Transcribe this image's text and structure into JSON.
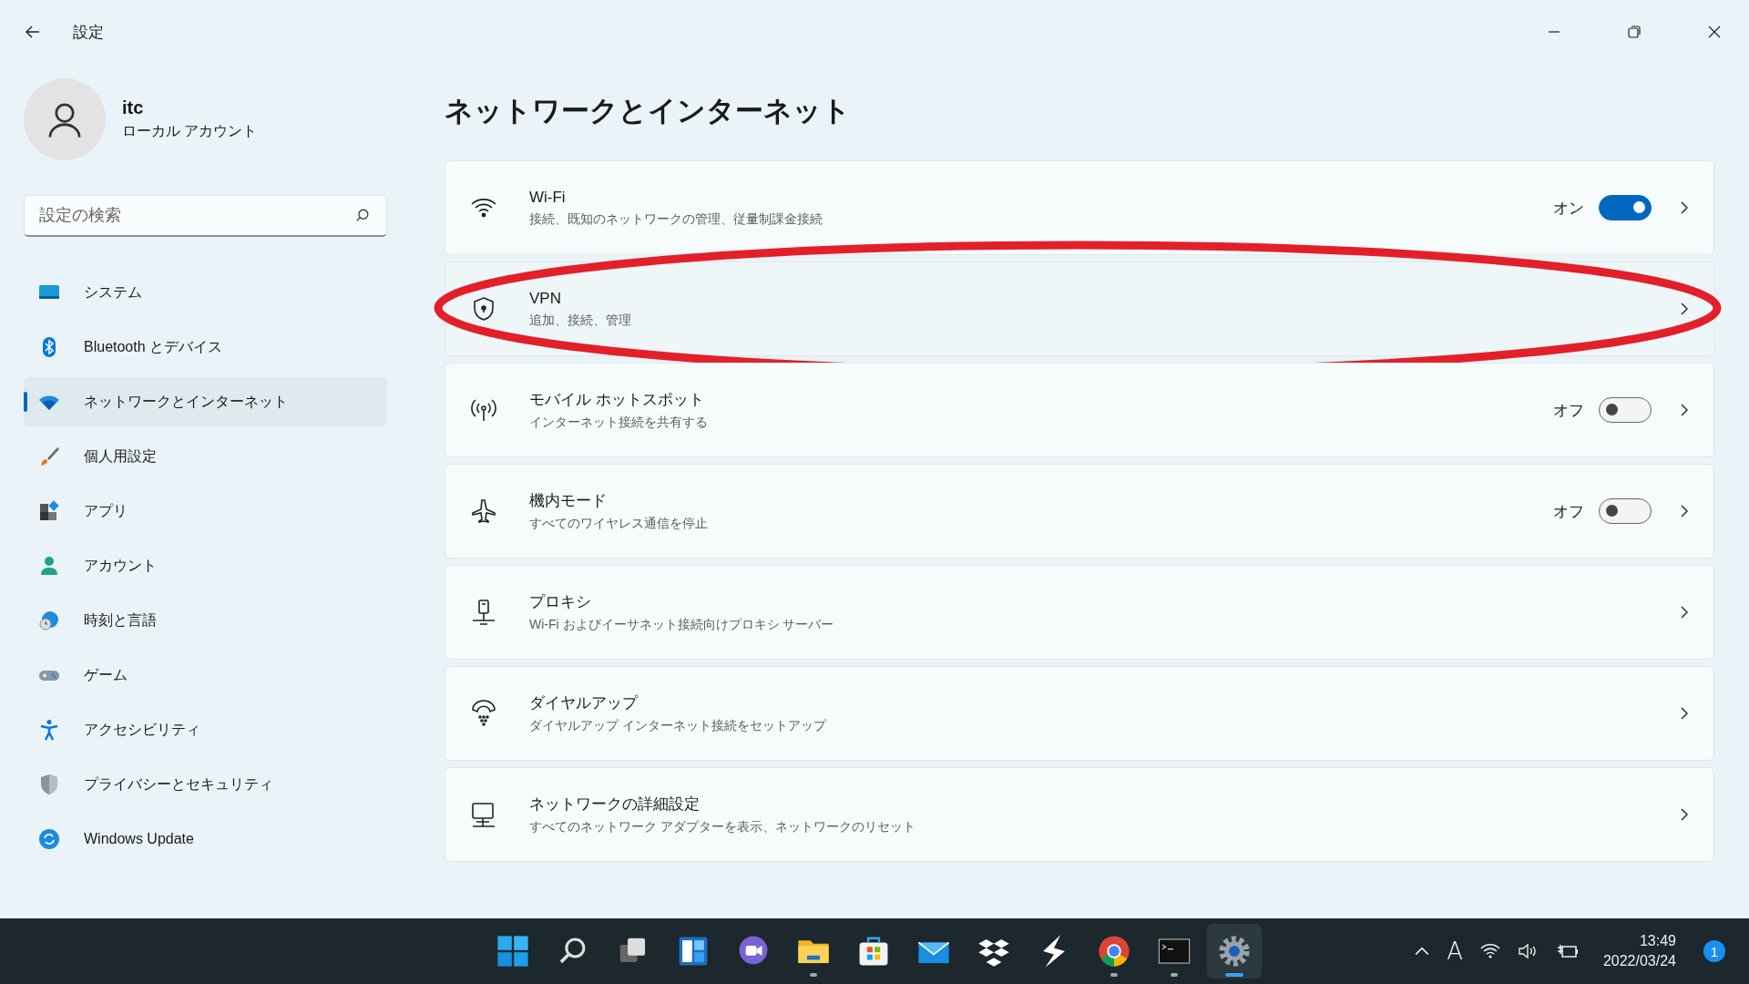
{
  "window": {
    "title": "設定"
  },
  "account": {
    "name": "itc",
    "type": "ローカル アカウント"
  },
  "search": {
    "placeholder": "設定の検索"
  },
  "sidebar": {
    "items": [
      {
        "label": "システム",
        "kind": "system",
        "selected": false
      },
      {
        "label": "Bluetooth とデバイス",
        "kind": "bluetooth",
        "selected": false
      },
      {
        "label": "ネットワークとインターネット",
        "kind": "network",
        "selected": true
      },
      {
        "label": "個人用設定",
        "kind": "brush",
        "selected": false
      },
      {
        "label": "アプリ",
        "kind": "apps",
        "selected": false
      },
      {
        "label": "アカウント",
        "kind": "account",
        "selected": false
      },
      {
        "label": "時刻と言語",
        "kind": "time",
        "selected": false
      },
      {
        "label": "ゲーム",
        "kind": "game",
        "selected": false
      },
      {
        "label": "アクセシビリティ",
        "kind": "access",
        "selected": false
      },
      {
        "label": "プライバシーとセキュリティ",
        "kind": "privacy",
        "selected": false
      },
      {
        "label": "Windows Update",
        "kind": "update",
        "selected": false
      }
    ]
  },
  "page": {
    "title": "ネットワークとインターネット"
  },
  "rows": [
    {
      "kind": "wifi",
      "title": "Wi-Fi",
      "subtitle": "接続、既知のネットワークの管理、従量制課金接続",
      "highlighted": false,
      "toggle": {
        "label": "オン",
        "on": true
      }
    },
    {
      "kind": "vpn",
      "title": "VPN",
      "subtitle": "追加、接続、管理",
      "highlighted": true
    },
    {
      "kind": "hotspot",
      "title": "モバイル ホットスポット",
      "subtitle": "インターネット接続を共有する",
      "highlighted": false,
      "toggle": {
        "label": "オフ",
        "on": false
      }
    },
    {
      "kind": "airplane",
      "title": "機内モード",
      "subtitle": "すべてのワイヤレス通信を停止",
      "highlighted": false,
      "toggle": {
        "label": "オフ",
        "on": false
      }
    },
    {
      "kind": "proxy",
      "title": "プロキシ",
      "subtitle": "Wi-Fi およびイーサネット接続向けプロキシ サーバー",
      "highlighted": false
    },
    {
      "kind": "dialup",
      "title": "ダイヤルアップ",
      "subtitle": "ダイヤルアップ インターネット接続をセットアップ",
      "highlighted": false
    },
    {
      "kind": "advanced",
      "title": "ネットワークの詳細設定",
      "subtitle": "すべてのネットワーク アダプターを表示、ネットワークのリセット",
      "highlighted": false
    }
  ],
  "taskbar": {
    "apps": [
      {
        "kind": "start",
        "running": false,
        "active": false
      },
      {
        "kind": "search",
        "running": false,
        "active": false
      },
      {
        "kind": "taskview",
        "running": false,
        "active": false
      },
      {
        "kind": "widgets",
        "running": false,
        "active": false
      },
      {
        "kind": "chat",
        "running": false,
        "active": false
      },
      {
        "kind": "explorer",
        "running": true,
        "active": false
      },
      {
        "kind": "store",
        "running": false,
        "active": false
      },
      {
        "kind": "mail",
        "running": false,
        "active": false
      },
      {
        "kind": "dropbox",
        "running": false,
        "active": false
      },
      {
        "kind": "bolt",
        "running": false,
        "active": false
      },
      {
        "kind": "chrome",
        "running": true,
        "active": false
      },
      {
        "kind": "terminal",
        "running": true,
        "active": false
      },
      {
        "kind": "settings",
        "running": true,
        "active": true
      }
    ],
    "ime": "A",
    "time": "13:49",
    "date": "2022/03/24",
    "notifications": "1"
  }
}
